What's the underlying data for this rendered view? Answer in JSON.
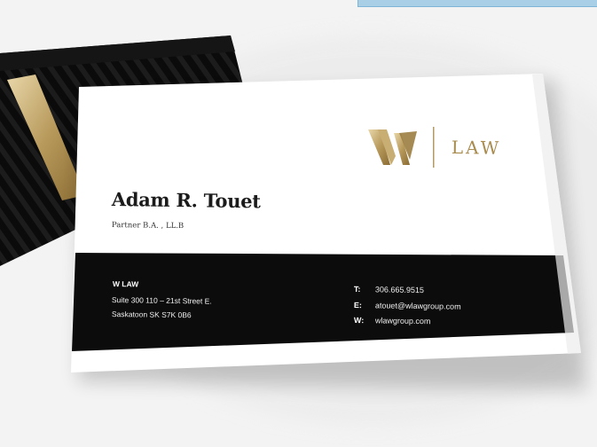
{
  "card": {
    "logo_mark": "W",
    "logo_word": "LAW",
    "name": "Adam R. Touet",
    "title": "Partner B.A. , LL.B",
    "firm": "W LAW",
    "address_line1": "Suite 300 110 – 21st Street E.",
    "address_line2": "Saskatoon SK S7K 0B6",
    "contact": [
      {
        "label": "T:",
        "value": "306.665.9515"
      },
      {
        "label": "E:",
        "value": "atouet@wlawgroup.com"
      },
      {
        "label": "W:",
        "value": "wlawgroup.com"
      }
    ]
  },
  "colors": {
    "gold": "#a88b4e",
    "black": "#0c0c0c",
    "card": "#ffffff",
    "background": "#f2f2f2",
    "top_strip": "#a9cfe6"
  }
}
